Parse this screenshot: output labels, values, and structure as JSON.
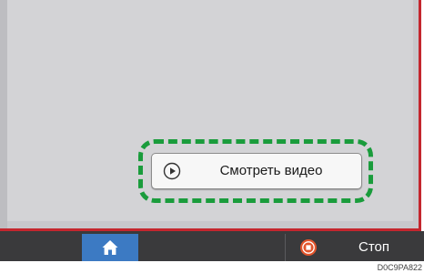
{
  "video_button": {
    "label": "Смотреть видео",
    "icon": "play-circle-icon"
  },
  "bottom_bar": {
    "home_icon": "home-icon",
    "stop_icon": "stop-icon",
    "stop_label": "Стоп"
  },
  "figure_code": "D0C9PA822",
  "colors": {
    "screen_background": "#d3d3d6",
    "frame_accent": "#c4262e",
    "highlight_dash": "#1a9c3c",
    "bottom_bar": "#3a3a3c",
    "home_button": "#3c7ac3",
    "stop_icon": "#e2552c"
  }
}
